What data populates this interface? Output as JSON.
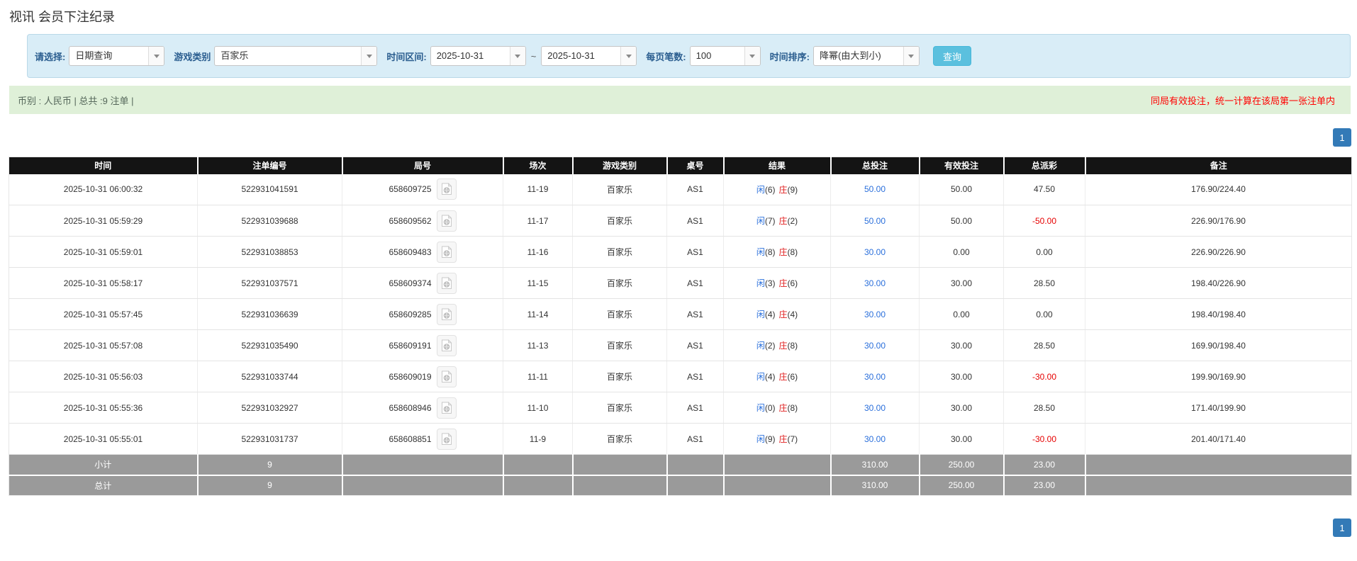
{
  "page": {
    "title": "视讯 会员下注纪录"
  },
  "filters": {
    "select_label": "请选择:",
    "select_value": "日期查询",
    "game_label": "游戏类别",
    "game_value": "百家乐",
    "range_label": "时间区间:",
    "date_from": "2025-10-31",
    "tilde": "~",
    "date_to": "2025-10-31",
    "page_size_label": "每页笔数:",
    "page_size_value": "100",
    "sort_label": "时间排序:",
    "sort_value": "降幂(由大到小)",
    "search_button": "查询"
  },
  "info_bar": {
    "left_text": "币别 : 人民币 | 总共 :9 注单 |",
    "right_note": "同局有效投注，统一计算在该局第一张注单内"
  },
  "pagination": {
    "current_page": "1"
  },
  "icons": {
    "combo_arrow": "chevron-down triangle",
    "round_video": "video-record document with film reel"
  },
  "colors": {
    "panel_bg": "#d9edf7",
    "info_bg": "#dff0d8",
    "note_red": "#ff0000",
    "search_btn": "#5bc0de",
    "pager_blue": "#337ab7",
    "header_bg": "#141414",
    "summary_bg": "#9a9a9a",
    "link_blue": "#2a6fdb",
    "player_blue": "#2a6fdb",
    "banker_red": "#e02020",
    "negative_red": "#e60000"
  },
  "table": {
    "headers": [
      "时间",
      "注单编号",
      "局号",
      "场次",
      "游戏类别",
      "桌号",
      "结果",
      "总投注",
      "有效投注",
      "总派彩",
      "备注"
    ],
    "rows": [
      {
        "time": "2025-10-31 06:00:32",
        "bet_id": "522931041591",
        "round": "658609725",
        "session": "11-19",
        "game": "百家乐",
        "table_no": "AS1",
        "result_p": "闲",
        "result_pn": "(6)",
        "result_b": "庄",
        "result_bn": "(9)",
        "total_bet": "50.00",
        "valid_bet": "50.00",
        "payout": "47.50",
        "remark": "176.90/224.40"
      },
      {
        "time": "2025-10-31 05:59:29",
        "bet_id": "522931039688",
        "round": "658609562",
        "session": "11-17",
        "game": "百家乐",
        "table_no": "AS1",
        "result_p": "闲",
        "result_pn": "(7)",
        "result_b": "庄",
        "result_bn": "(2)",
        "total_bet": "50.00",
        "valid_bet": "50.00",
        "payout": "-50.00",
        "remark": "226.90/176.90"
      },
      {
        "time": "2025-10-31 05:59:01",
        "bet_id": "522931038853",
        "round": "658609483",
        "session": "11-16",
        "game": "百家乐",
        "table_no": "AS1",
        "result_p": "闲",
        "result_pn": "(8)",
        "result_b": "庄",
        "result_bn": "(8)",
        "total_bet": "30.00",
        "valid_bet": "0.00",
        "payout": "0.00",
        "remark": "226.90/226.90"
      },
      {
        "time": "2025-10-31 05:58:17",
        "bet_id": "522931037571",
        "round": "658609374",
        "session": "11-15",
        "game": "百家乐",
        "table_no": "AS1",
        "result_p": "闲",
        "result_pn": "(3)",
        "result_b": "庄",
        "result_bn": "(6)",
        "total_bet": "30.00",
        "valid_bet": "30.00",
        "payout": "28.50",
        "remark": "198.40/226.90"
      },
      {
        "time": "2025-10-31 05:57:45",
        "bet_id": "522931036639",
        "round": "658609285",
        "session": "11-14",
        "game": "百家乐",
        "table_no": "AS1",
        "result_p": "闲",
        "result_pn": "(4)",
        "result_b": "庄",
        "result_bn": "(4)",
        "total_bet": "30.00",
        "valid_bet": "0.00",
        "payout": "0.00",
        "remark": "198.40/198.40"
      },
      {
        "time": "2025-10-31 05:57:08",
        "bet_id": "522931035490",
        "round": "658609191",
        "session": "11-13",
        "game": "百家乐",
        "table_no": "AS1",
        "result_p": "闲",
        "result_pn": "(2)",
        "result_b": "庄",
        "result_bn": "(8)",
        "total_bet": "30.00",
        "valid_bet": "30.00",
        "payout": "28.50",
        "remark": "169.90/198.40"
      },
      {
        "time": "2025-10-31 05:56:03",
        "bet_id": "522931033744",
        "round": "658609019",
        "session": "11-11",
        "game": "百家乐",
        "table_no": "AS1",
        "result_p": "闲",
        "result_pn": "(4)",
        "result_b": "庄",
        "result_bn": "(6)",
        "total_bet": "30.00",
        "valid_bet": "30.00",
        "payout": "-30.00",
        "remark": "199.90/169.90"
      },
      {
        "time": "2025-10-31 05:55:36",
        "bet_id": "522931032927",
        "round": "658608946",
        "session": "11-10",
        "game": "百家乐",
        "table_no": "AS1",
        "result_p": "闲",
        "result_pn": "(0)",
        "result_b": "庄",
        "result_bn": "(8)",
        "total_bet": "30.00",
        "valid_bet": "30.00",
        "payout": "28.50",
        "remark": "171.40/199.90"
      },
      {
        "time": "2025-10-31 05:55:01",
        "bet_id": "522931031737",
        "round": "658608851",
        "session": "11-9",
        "game": "百家乐",
        "table_no": "AS1",
        "result_p": "闲",
        "result_pn": "(9)",
        "result_b": "庄",
        "result_bn": "(7)",
        "total_bet": "30.00",
        "valid_bet": "30.00",
        "payout": "-30.00",
        "remark": "201.40/171.40"
      }
    ],
    "subtotal": {
      "label": "小计",
      "count": "9",
      "total_bet": "310.00",
      "valid_bet": "250.00",
      "payout": "23.00"
    },
    "total": {
      "label": "总计",
      "count": "9",
      "total_bet": "310.00",
      "valid_bet": "250.00",
      "payout": "23.00"
    }
  }
}
